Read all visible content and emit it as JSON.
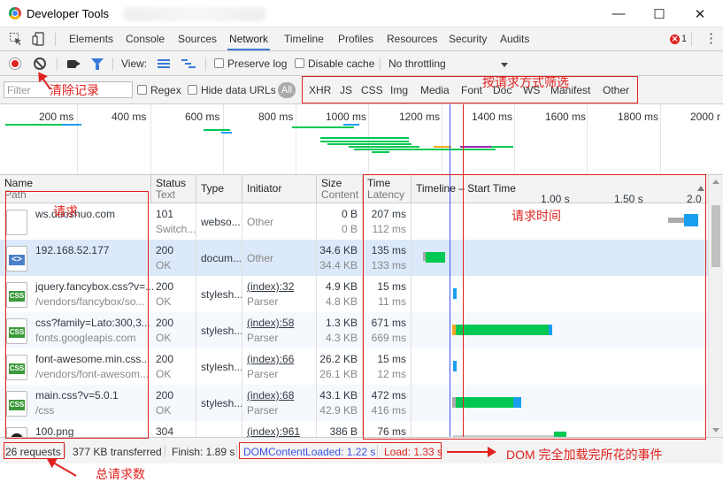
{
  "window": {
    "title": "Developer Tools",
    "minimize": "—",
    "maximize": "☐",
    "close": "✕"
  },
  "tabs": [
    "Elements",
    "Console",
    "Sources",
    "Network",
    "Timeline",
    "Profiles",
    "Resources",
    "Security",
    "Audits"
  ],
  "active_tab": "Network",
  "error_count": "1",
  "toolbar": {
    "view_label": "View:",
    "preserve_log": "Preserve log",
    "disable_cache": "Disable cache",
    "throttling": "No throttling"
  },
  "filter": {
    "placeholder": "Filter",
    "regex": "Regex",
    "hide_data_urls": "Hide data URLs",
    "all": "All",
    "types": [
      "XHR",
      "JS",
      "CSS",
      "Img",
      "Media",
      "Font",
      "Doc",
      "WS",
      "Manifest",
      "Other"
    ]
  },
  "overview": {
    "ticks": [
      "200 ms",
      "400 ms",
      "600 ms",
      "800 ms",
      "1000 ms",
      "1200 ms",
      "1400 ms",
      "1600 ms",
      "1800 ms",
      "2000 r"
    ]
  },
  "columns": {
    "name": "Name",
    "name_sub": "Path",
    "status": "Status",
    "status_sub": "Text",
    "type": "Type",
    "initiator": "Initiator",
    "size": "Size",
    "size_sub": "Content",
    "time": "Time",
    "time_sub": "Latency",
    "timeline": "Timeline – Start Time",
    "timeline_ticks": [
      "1.00 s",
      "1.50 s",
      "2.0"
    ]
  },
  "rows": [
    {
      "name": "ws.duoshuo.com",
      "path": "",
      "status": "101",
      "status_text": "Switch...",
      "type": "webso...",
      "initiator": "Other",
      "initiator_sub": "",
      "size": "0 B",
      "content": "0 B",
      "time": "207 ms",
      "latency": "112 ms",
      "icon": "blank"
    },
    {
      "name": "192.168.52.177",
      "path": "",
      "status": "200",
      "status_text": "OK",
      "type": "docum...",
      "initiator": "Other",
      "initiator_sub": "",
      "size": "34.6 KB",
      "content": "34.4 KB",
      "time": "135 ms",
      "latency": "133 ms",
      "icon": "doc"
    },
    {
      "name": "jquery.fancybox.css?v=...",
      "path": "/vendors/fancybox/so...",
      "status": "200",
      "status_text": "OK",
      "type": "stylesh...",
      "initiator": "(index):32",
      "initiator_sub": "Parser",
      "size": "4.9 KB",
      "content": "4.8 KB",
      "time": "15 ms",
      "latency": "11 ms",
      "icon": "css"
    },
    {
      "name": "css?family=Lato:300,3...",
      "path": "fonts.googleapis.com",
      "status": "200",
      "status_text": "OK",
      "type": "stylesh...",
      "initiator": "(index):58",
      "initiator_sub": "Parser",
      "size": "1.3 KB",
      "content": "4.3 KB",
      "time": "671 ms",
      "latency": "669 ms",
      "icon": "css"
    },
    {
      "name": "font-awesome.min.css...",
      "path": "/vendors/font-awesom...",
      "status": "200",
      "status_text": "OK",
      "type": "stylesh...",
      "initiator": "(index):66",
      "initiator_sub": "Parser",
      "size": "26.2 KB",
      "content": "26.1 KB",
      "time": "15 ms",
      "latency": "12 ms",
      "icon": "css"
    },
    {
      "name": "main.css?v=5.0.1",
      "path": "/css",
      "status": "200",
      "status_text": "OK",
      "type": "stylesh...",
      "initiator": "(index):68",
      "initiator_sub": "Parser",
      "size": "43.1 KB",
      "content": "42.9 KB",
      "time": "472 ms",
      "latency": "416 ms",
      "icon": "css"
    },
    {
      "name": "100.png",
      "path": "",
      "status": "304",
      "status_text": "",
      "type": "",
      "initiator": "(index):961",
      "initiator_sub": "",
      "size": "386 B",
      "content": "",
      "time": "76 ms",
      "latency": "",
      "icon": "img"
    }
  ],
  "status": {
    "requests": "26 requests",
    "transferred": "377 KB transferred",
    "finish": "Finish: 1.89 s",
    "dom": "DOMContentLoaded: 1.22 s",
    "load": "Load: 1.33 s"
  },
  "annotations": {
    "clear": "清除记录",
    "filter_by_type": "按请求方式筛选",
    "requests": "请求",
    "request_time": "请求时间",
    "total": "总请求数",
    "dom_event": "DOM 完全加载完所花的事件"
  },
  "colors": {
    "accent": "#3879d9",
    "annotation": "#e0221f",
    "waiting": "#00c853",
    "download": "#1a9ef0",
    "dom_line": "#3c52e6",
    "load_line": "#e0221f"
  }
}
